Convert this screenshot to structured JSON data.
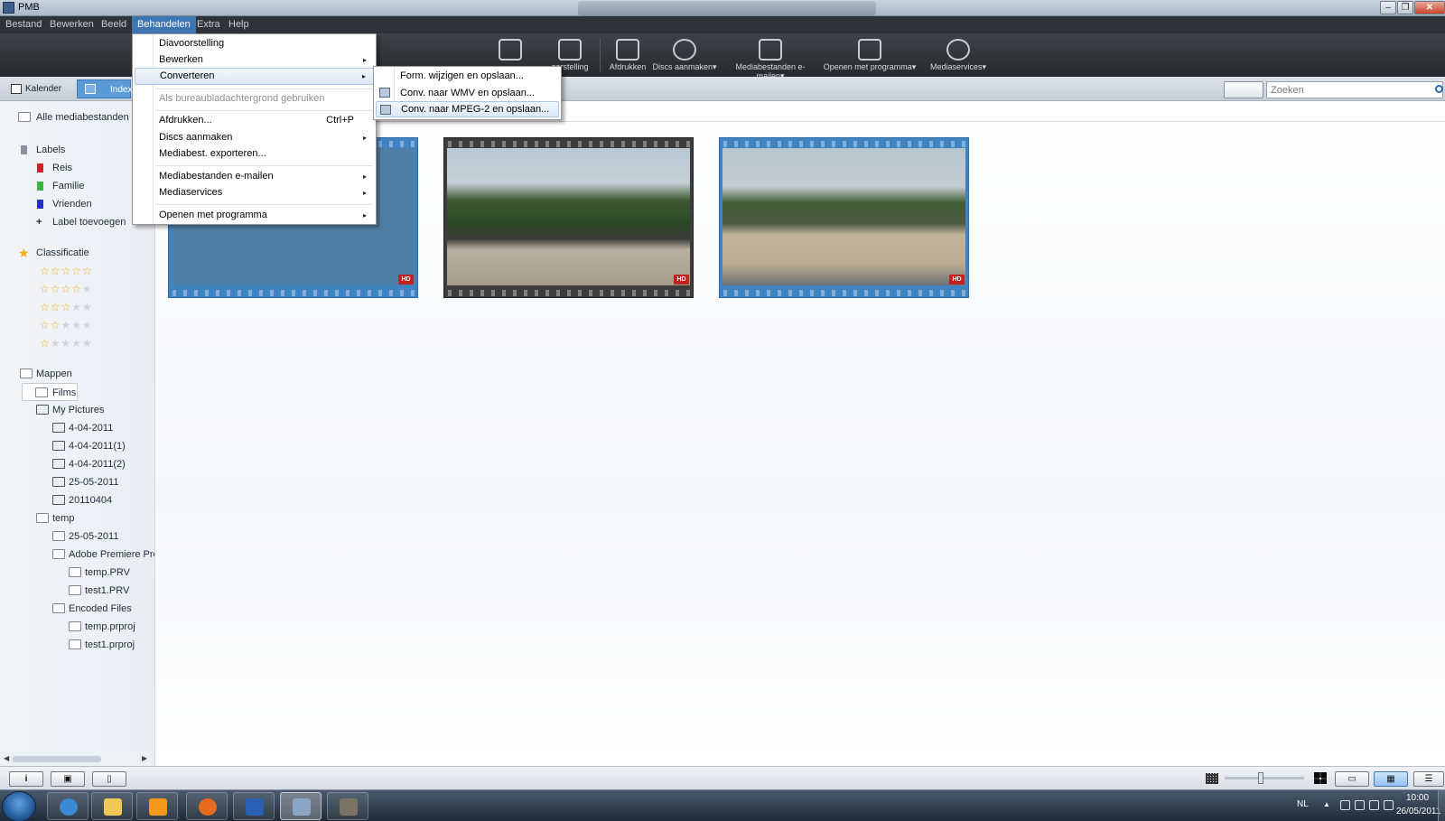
{
  "window": {
    "title": "PMB"
  },
  "menubar": [
    "Bestand",
    "Bewerken",
    "Beeld",
    "Behandelen",
    "Extra",
    "Help"
  ],
  "toolbar": {
    "slideshow_label": "oorstelling",
    "print_label": "Afdrukken",
    "discs_label": "Discs aanmaken",
    "email_label": "Mediabestanden e-mailen",
    "open_label": "Openen met programma",
    "services_label": "Mediaservices",
    "dropdown_glyph": "▾"
  },
  "viewbar": {
    "calendar_tab": "Kalender",
    "index_tab": "Index",
    "search_placeholder": "Zoeken"
  },
  "sidebar": {
    "all_media": "Alle mediabestanden",
    "labels_heading": "Labels",
    "labels": [
      {
        "name": "Reis",
        "color": "#d4202a"
      },
      {
        "name": "Familie",
        "color": "#35b540"
      },
      {
        "name": "Vrienden",
        "color": "#2430c8"
      }
    ],
    "add_label": "Label toevoegen",
    "rating_heading": "Classificatie",
    "ratings": [
      5,
      4,
      3,
      2,
      1
    ],
    "folders_heading": "Mappen",
    "folders": [
      "Films",
      "My Pictures",
      "4-04-2011",
      "4-04-2011(1)",
      "4-04-2011(2)",
      "25-05-2011",
      "20110404",
      "temp",
      "25-05-2011",
      "Adobe Premiere Pro",
      "temp.PRV",
      "test1.PRV",
      "Encoded Files",
      "temp.prproj",
      "test1.prproj"
    ]
  },
  "thumbnails": [
    {
      "badge": "HD",
      "selected": true
    },
    {
      "badge": "HD",
      "selected": false
    },
    {
      "badge": "HD",
      "selected": true
    }
  ],
  "behandelen_menu": {
    "items": [
      {
        "label": "Diavoorstelling"
      },
      {
        "label": "Bewerken",
        "submenu": true
      },
      {
        "label": "Converteren",
        "submenu": true,
        "highlighted": true
      },
      {
        "label": "Als bureaubladachtergrond gebruiken",
        "disabled": true
      },
      {
        "label": "Afdrukken...",
        "shortcut": "Ctrl+P"
      },
      {
        "label": "Discs aanmaken",
        "submenu": true
      },
      {
        "label": "Mediabest. exporteren..."
      },
      {
        "label": "Mediabestanden e-mailen",
        "submenu": true
      },
      {
        "label": "Mediaservices",
        "submenu": true
      },
      {
        "label": "Openen met programma",
        "submenu": true
      }
    ],
    "arrow_glyph": "▸"
  },
  "converteren_submenu": {
    "items": [
      {
        "label": "Form. wijzigen en opslaan..."
      },
      {
        "label": "Conv. naar WMV en opslaan..."
      },
      {
        "label": "Conv. naar MPEG-2 en opslaan...",
        "highlighted": true
      }
    ]
  },
  "statusbar": {
    "info_glyph": "i"
  },
  "taskbar": {
    "language": "NL",
    "time": "10:00",
    "date": "26/05/2011"
  }
}
